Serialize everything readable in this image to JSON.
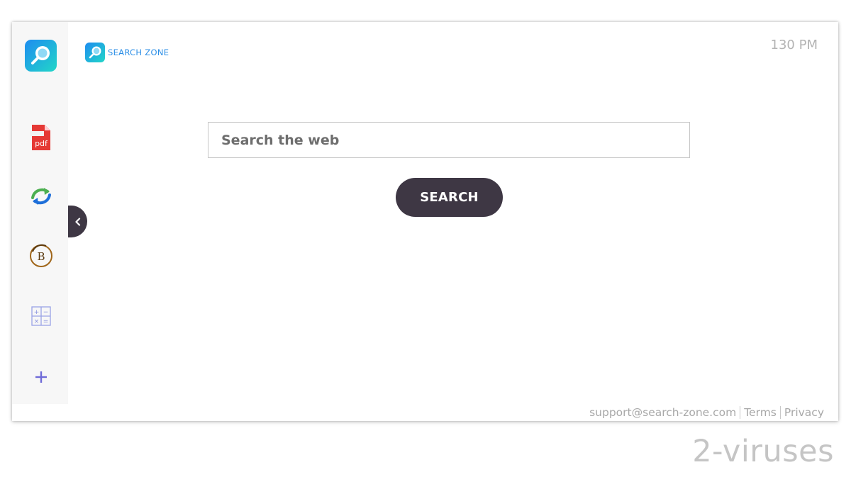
{
  "brand": {
    "name": "SEARCH ZONE",
    "color": "#2b8ee6",
    "icon": "magnifier-icon"
  },
  "clock": {
    "time": "130 PM"
  },
  "search": {
    "placeholder": "Search the web",
    "value": "",
    "button_label": "SEARCH"
  },
  "sidebar": {
    "items": [
      {
        "name": "search-zone-app",
        "icon": "magnifier-icon"
      },
      {
        "name": "pdf-tool",
        "icon": "pdf-file-icon"
      },
      {
        "name": "converter",
        "icon": "sync-arrows-icon"
      },
      {
        "name": "bitcoin-tracker",
        "icon": "bitcoin-icon"
      },
      {
        "name": "calculator",
        "icon": "calculator-icon"
      },
      {
        "name": "add-shortcut",
        "icon": "plus-icon"
      }
    ],
    "collapse_icon": "chevron-left-icon"
  },
  "footer": {
    "support_email": "support@search-zone.com",
    "terms": "Terms",
    "privacy": "Privacy"
  },
  "watermark": {
    "text": "2-viruses"
  },
  "colors": {
    "dark_button": "#3e3744",
    "text_muted": "#a8a8a8",
    "sidebar_bg": "#f7f7f7"
  }
}
